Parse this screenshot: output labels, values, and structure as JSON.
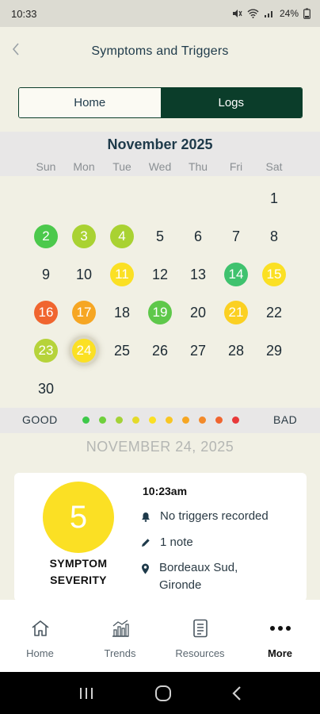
{
  "status_bar": {
    "time": "10:33",
    "battery": "24%"
  },
  "header": {
    "title": "Symptoms and Triggers"
  },
  "tabs": [
    {
      "label": "Home",
      "active": false
    },
    {
      "label": "Logs",
      "active": true
    }
  ],
  "calendar": {
    "month_label": "November 2025",
    "weekdays": [
      "Sun",
      "Mon",
      "Tue",
      "Wed",
      "Thu",
      "Fri",
      "Sat"
    ],
    "leading_blanks": 6,
    "selected_day": 24,
    "days": [
      {
        "day": "1",
        "color": null
      },
      {
        "day": "2",
        "color": "#4cc94c"
      },
      {
        "day": "3",
        "color": "#a9d232"
      },
      {
        "day": "4",
        "color": "#a9d232"
      },
      {
        "day": "5",
        "color": null
      },
      {
        "day": "6",
        "color": null
      },
      {
        "day": "7",
        "color": null
      },
      {
        "day": "8",
        "color": null
      },
      {
        "day": "9",
        "color": null
      },
      {
        "day": "10",
        "color": null
      },
      {
        "day": "11",
        "color": "#fbe024"
      },
      {
        "day": "12",
        "color": null
      },
      {
        "day": "13",
        "color": null
      },
      {
        "day": "14",
        "color": "#3fc26e"
      },
      {
        "day": "15",
        "color": "#fbe024"
      },
      {
        "day": "16",
        "color": "#f0652f"
      },
      {
        "day": "17",
        "color": "#f6a623"
      },
      {
        "day": "18",
        "color": null
      },
      {
        "day": "19",
        "color": "#5ec84a"
      },
      {
        "day": "20",
        "color": null
      },
      {
        "day": "21",
        "color": "#fbd022"
      },
      {
        "day": "22",
        "color": null
      },
      {
        "day": "23",
        "color": "#b6d33a"
      },
      {
        "day": "24",
        "color": "#fbe024"
      },
      {
        "day": "25",
        "color": null
      },
      {
        "day": "26",
        "color": null
      },
      {
        "day": "27",
        "color": null
      },
      {
        "day": "28",
        "color": null
      },
      {
        "day": "29",
        "color": null
      },
      {
        "day": "30",
        "color": null
      }
    ]
  },
  "legend": {
    "good_label": "GOOD",
    "bad_label": "BAD",
    "dots": [
      "#3ec94a",
      "#6fd03c",
      "#a4d237",
      "#e4da2a",
      "#fbe024",
      "#f8c623",
      "#f6a623",
      "#f38a2a",
      "#f0652f",
      "#e8393a"
    ]
  },
  "selected_date_label": "NOVEMBER 24, 2025",
  "entry": {
    "severity_value": "5",
    "severity_color": "#fbe024",
    "severity_label_line1": "SYMPTOM",
    "severity_label_line2": "SEVERITY",
    "time": "10:23am",
    "triggers": "No triggers recorded",
    "notes": "1 note",
    "location_line1": "Bordeaux Sud,",
    "location_line2": "Gironde"
  },
  "bottom_nav": [
    {
      "label": "Home",
      "icon": "home-icon",
      "active": false
    },
    {
      "label": "Trends",
      "icon": "trends-icon",
      "active": false
    },
    {
      "label": "Resources",
      "icon": "resources-icon",
      "active": false
    },
    {
      "label": "More",
      "icon": "more-icon",
      "active": true
    }
  ]
}
